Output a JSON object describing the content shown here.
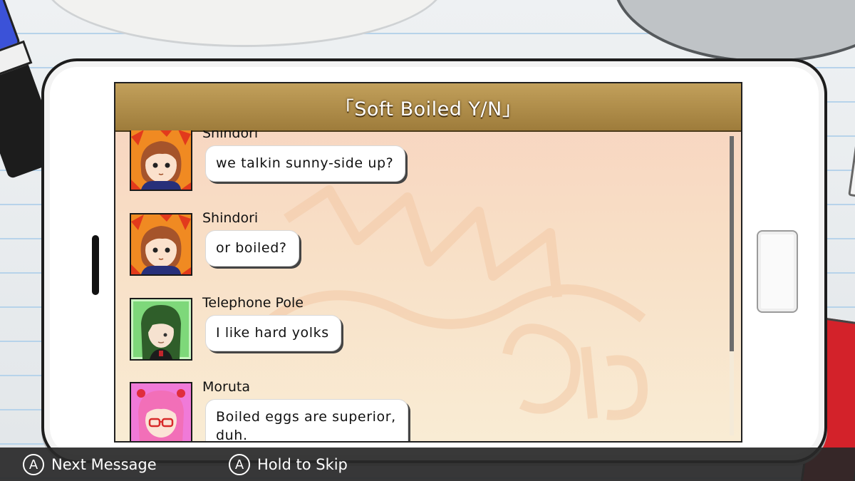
{
  "chat": {
    "title": "「Soft Boiled Y/N」",
    "messages": [
      {
        "sender": "Shindori",
        "text": "we talkin sunny-side up?",
        "avatar": "shindori-avatar"
      },
      {
        "sender": "Shindori",
        "text": "or boiled?",
        "avatar": "shindori-avatar"
      },
      {
        "sender": "Telephone Pole",
        "text": "I like hard yolks",
        "avatar": "telephone-pole-avatar"
      },
      {
        "sender": "Moruta",
        "text": "Boiled eggs are superior,\nduh.",
        "avatar": "moruta-avatar"
      }
    ],
    "scroll_fraction_visible": 0.72
  },
  "controls": {
    "next_button_glyph": "A",
    "next_label": "Next Message",
    "skip_button_glyph": "A",
    "skip_label": "Hold to Skip"
  },
  "colors": {
    "title_bar": "#b08d48",
    "screen_bg": "#f8dfc6",
    "bottom_bar": "#282828"
  }
}
